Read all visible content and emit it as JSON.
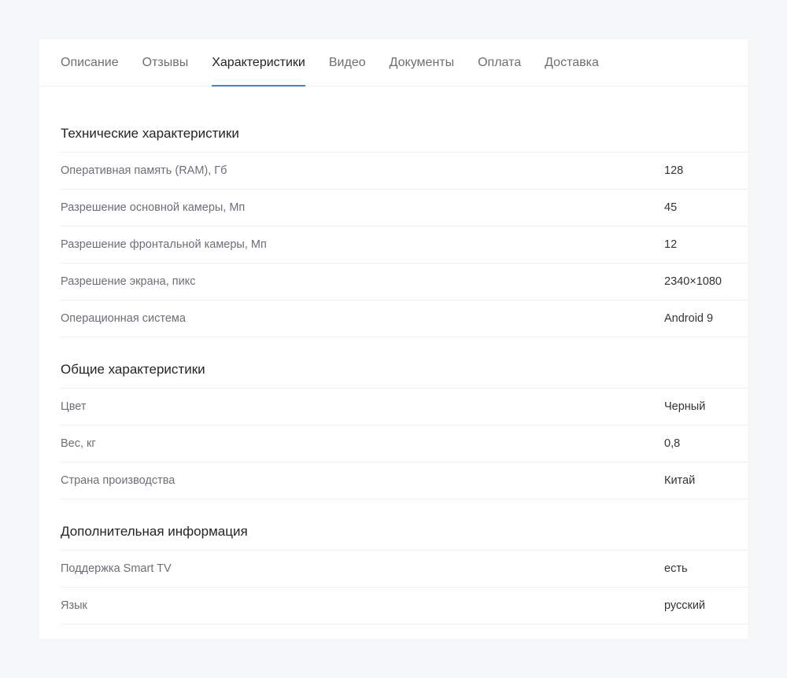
{
  "tabs": [
    {
      "label": "Описание",
      "active": false
    },
    {
      "label": "Отзывы",
      "active": false
    },
    {
      "label": "Характеристики",
      "active": true
    },
    {
      "label": "Видео",
      "active": false
    },
    {
      "label": "Документы",
      "active": false
    },
    {
      "label": "Оплата",
      "active": false
    },
    {
      "label": "Доставка",
      "active": false
    }
  ],
  "accent_color": "#4a7fd6",
  "sections": [
    {
      "title": "Технические характеристики",
      "rows": [
        {
          "label": "Оперативная память (RAM), Гб",
          "value": "128"
        },
        {
          "label": "Разрешение основной камеры, Мп",
          "value": "45"
        },
        {
          "label": "Разрешение фронтальной камеры, Мп",
          "value": "12"
        },
        {
          "label": "Разрешение экрана, пикс",
          "value": "2340×1080"
        },
        {
          "label": "Операционная система",
          "value": "Android 9"
        }
      ]
    },
    {
      "title": "Общие характеристики",
      "rows": [
        {
          "label": "Цвет",
          "value": "Черный"
        },
        {
          "label": "Вес, кг",
          "value": "0,8"
        },
        {
          "label": "Страна производства",
          "value": "Китай"
        }
      ]
    },
    {
      "title": "Дополнительная информация",
      "rows": [
        {
          "label": "Поддержка Smart TV",
          "value": "есть"
        },
        {
          "label": "Язык",
          "value": "русский"
        }
      ]
    }
  ]
}
